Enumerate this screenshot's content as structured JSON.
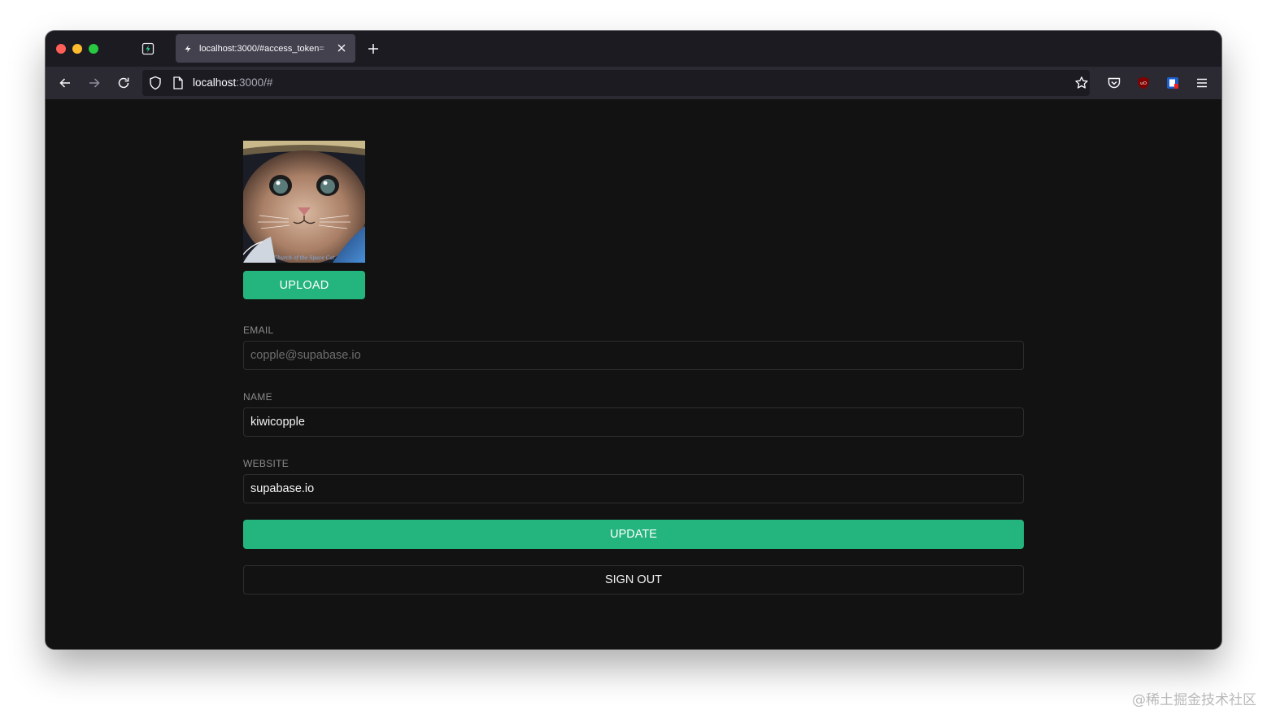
{
  "browser": {
    "tab_title": "localhost:3000/#access_token=",
    "url_host": "localhost",
    "url_path": ":3000/#"
  },
  "icons": {
    "sidebar": "sidebar-icon",
    "favicon": "supabase-icon",
    "tab_close": "close-icon",
    "new_tab": "plus-icon",
    "back": "arrow-left-icon",
    "forward": "arrow-right-icon",
    "reload": "reload-icon",
    "tracking": "shield-icon",
    "page": "page-icon",
    "bookmark": "star-icon",
    "pocket": "pocket-icon",
    "ublock": "ublock-icon",
    "extension": "extension-icon",
    "menu": "hamburger-icon"
  },
  "profile": {
    "upload_label": "UPLOAD",
    "email": {
      "label": "EMAIL",
      "value": "copple@supabase.io"
    },
    "name": {
      "label": "NAME",
      "value": "kiwicopple"
    },
    "website": {
      "label": "WEBSITE",
      "value": "supabase.io"
    },
    "update_label": "UPDATE",
    "signout_label": "SIGN OUT",
    "avatar_caption": "Church of the Space Cat"
  },
  "colors": {
    "accent": "#24b47e",
    "page_background": "#121212",
    "field_border": "#2e2e2e"
  },
  "watermark": "@稀土掘金技术社区"
}
